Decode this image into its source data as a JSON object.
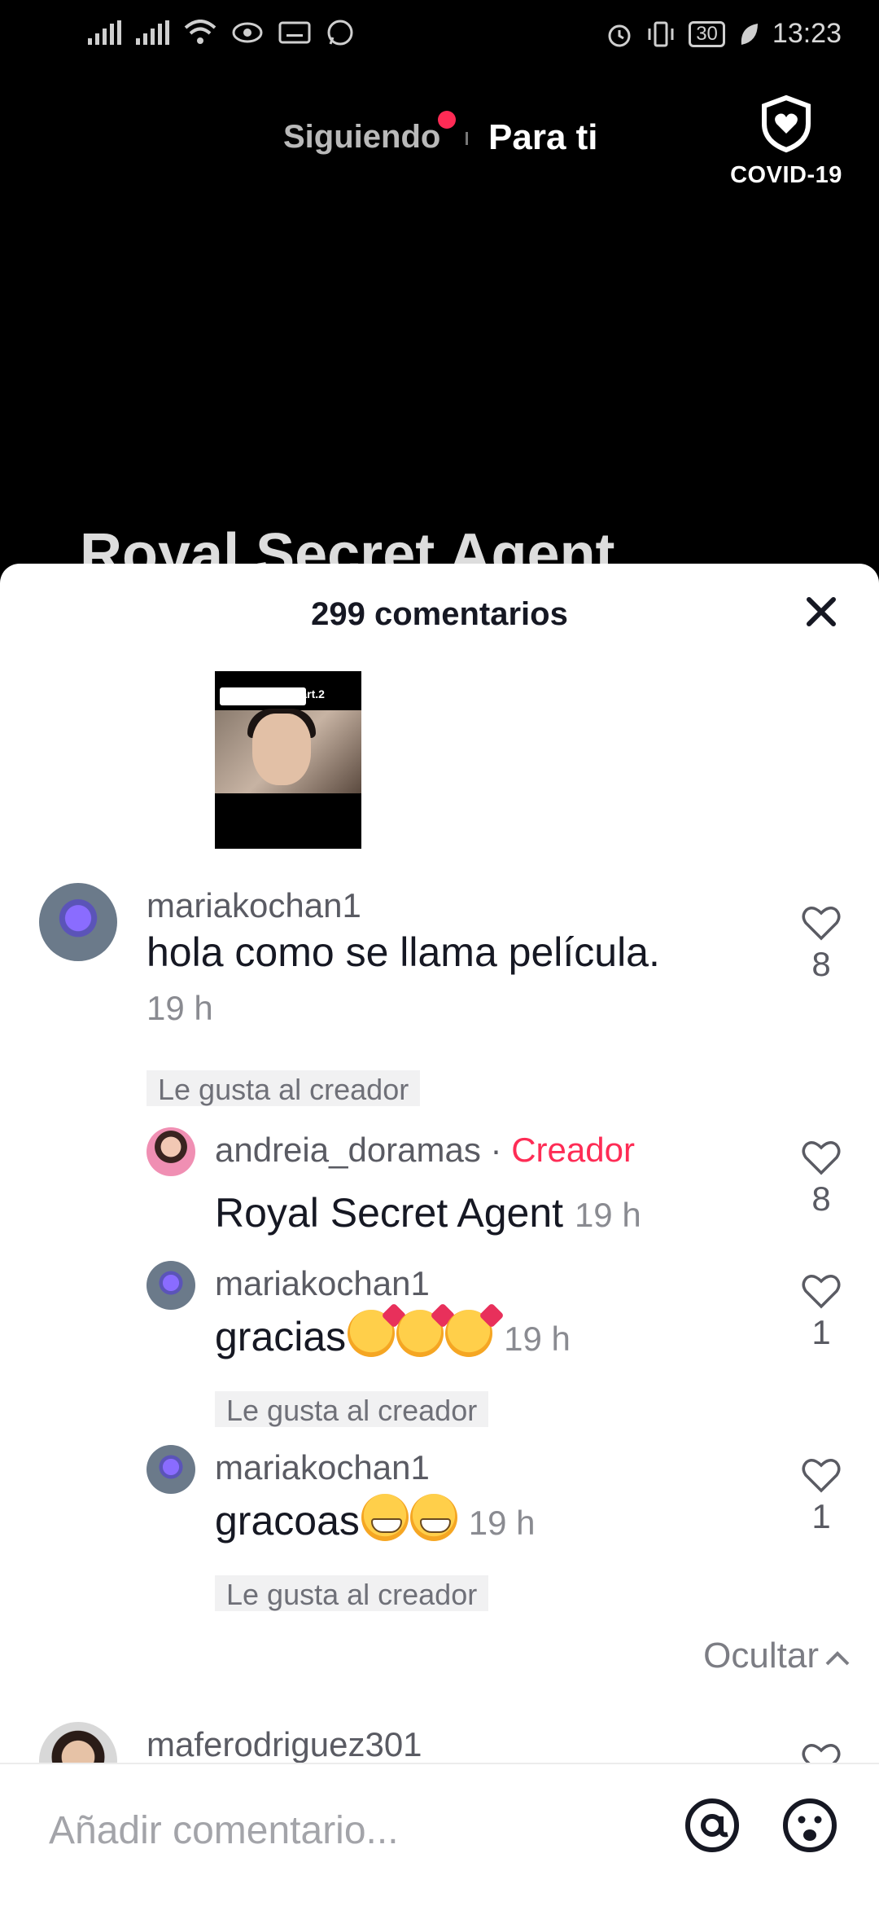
{
  "status": {
    "time": "13:23",
    "battery": "30"
  },
  "nav": {
    "following": "Siguiendo",
    "for_you": "Para ti",
    "covid": "COVID-19"
  },
  "video": {
    "title": "Royal Secret Agent",
    "thumb_label": "Part.2"
  },
  "comments_panel": {
    "header": "299 comentarios",
    "comments": [
      {
        "username": "mariakochan1",
        "text": "hola como se llama película.",
        "time": "19 h",
        "badge": "Le gusta al creador",
        "likes": "8"
      }
    ],
    "replies": [
      {
        "username": "andreia_doramas",
        "separator": "·",
        "role": "Creador",
        "text": "Royal Secret Agent",
        "time": "19 h",
        "likes": "8"
      },
      {
        "username": "mariakochan1",
        "text": "gracias",
        "emojis": [
          "smiling-face-with-hearts",
          "smiling-face-with-hearts",
          "smiling-face-with-hearts"
        ],
        "time": "19 h",
        "badge": "Le gusta al creador",
        "likes": "1"
      },
      {
        "username": "mariakochan1",
        "text": "gracoas",
        "emojis": [
          "grinning-face",
          "grinning-face"
        ],
        "time": "19 h",
        "badge": "Le gusta al creador",
        "likes": "1"
      }
    ],
    "hide_label": "Ocultar",
    "next_comment_username": "maferodriguez301"
  },
  "input": {
    "placeholder": "Añadir comentario..."
  },
  "colors": {
    "accent": "#fe2c55",
    "text": "#161823",
    "muted": "#8a8b91"
  }
}
